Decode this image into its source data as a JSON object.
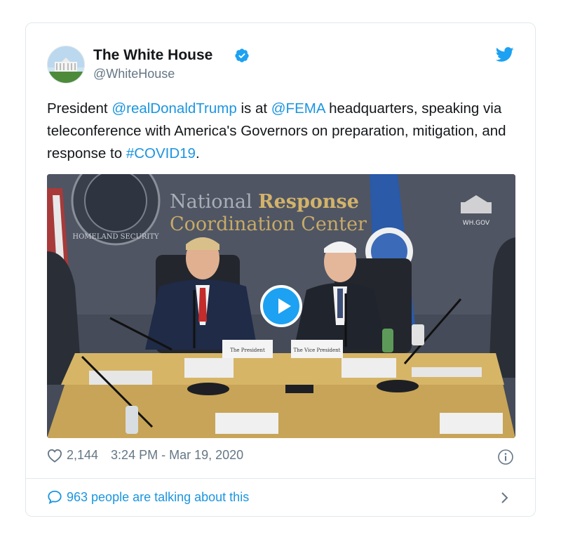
{
  "user": {
    "name": "The White House",
    "handle": "@WhiteHouse"
  },
  "tweet": {
    "t1": "President ",
    "mention1": "@realDonaldTrump",
    "t2": " is at ",
    "mention2": "@FEMA",
    "t3": " headquarters, speaking via teleconference with America's Governors on preparation, mitigation, and response to ",
    "hashtag": "#COVID19",
    "t4": "."
  },
  "media": {
    "sign_line1_a": "National ",
    "sign_line1_b": "Response",
    "sign_line2": "Coordination Center",
    "seal_text": "HOMELAND SECURITY",
    "watermark": "WH.GOV",
    "placard_left": "The President",
    "placard_right": "The Vice President"
  },
  "meta": {
    "likes": "2,144",
    "timestamp": "3:24 PM - Mar 19, 2020"
  },
  "footer": {
    "talking": "963 people are talking about this"
  },
  "colors": {
    "link": "#1b95e0",
    "play": "#1da1f2",
    "muted": "#657786"
  },
  "icons": [
    "white-house-avatar-icon",
    "verified-icon",
    "twitter-bird-icon",
    "play-icon",
    "heart-icon",
    "info-icon",
    "speech-bubble-icon",
    "chevron-right-icon"
  ]
}
